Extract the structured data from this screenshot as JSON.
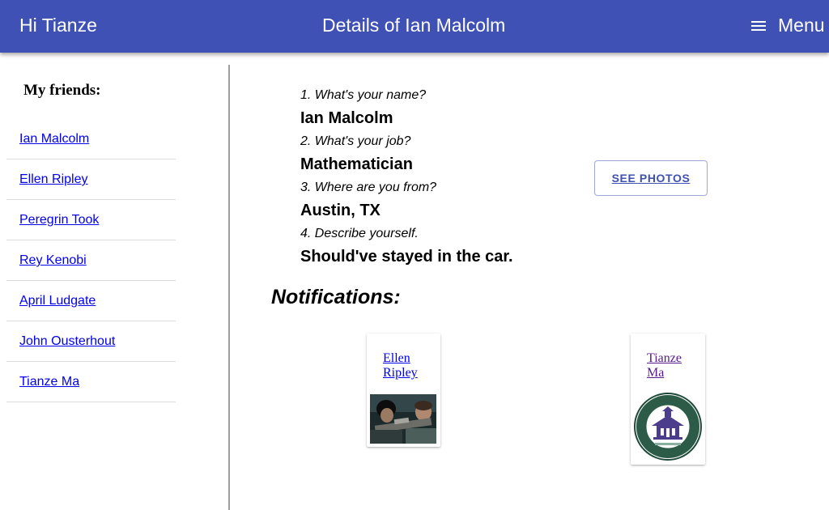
{
  "appbar": {
    "greeting": "Hi Tianze",
    "title": "Details of Ian Malcolm",
    "menu_label": "Menu",
    "color": "#3f51b5",
    "menu_icon": "hamburger-menu-icon"
  },
  "sidebar": {
    "heading": "My friends:",
    "friends": [
      "Ian Malcolm",
      "Ellen Ripley",
      "Peregrin Took",
      "Rey Kenobi",
      "April Ludgate",
      "John Ousterhout",
      "Tianze Ma"
    ]
  },
  "details": {
    "items": [
      {
        "question": "1. What's your name?",
        "answer": "Ian Malcolm"
      },
      {
        "question": "2. What's your job?",
        "answer": "Mathematician"
      },
      {
        "question": "3. Where are you from?",
        "answer": "Austin, TX"
      },
      {
        "question": "4. Describe yourself.",
        "answer": "Should've stayed in the car."
      }
    ],
    "see_photos_label": "SEE PHOTOS"
  },
  "notifications": {
    "heading": "Notifications:",
    "cards": [
      {
        "name_line1": "Ellen",
        "name_line2": "Ripley",
        "image": "movie-still-photo",
        "link_color": "#0000ee"
      },
      {
        "name_line1": "Tianze",
        "name_line2": "Ma",
        "image": "university-seal-logo",
        "link_color": "#551a8b"
      }
    ]
  }
}
